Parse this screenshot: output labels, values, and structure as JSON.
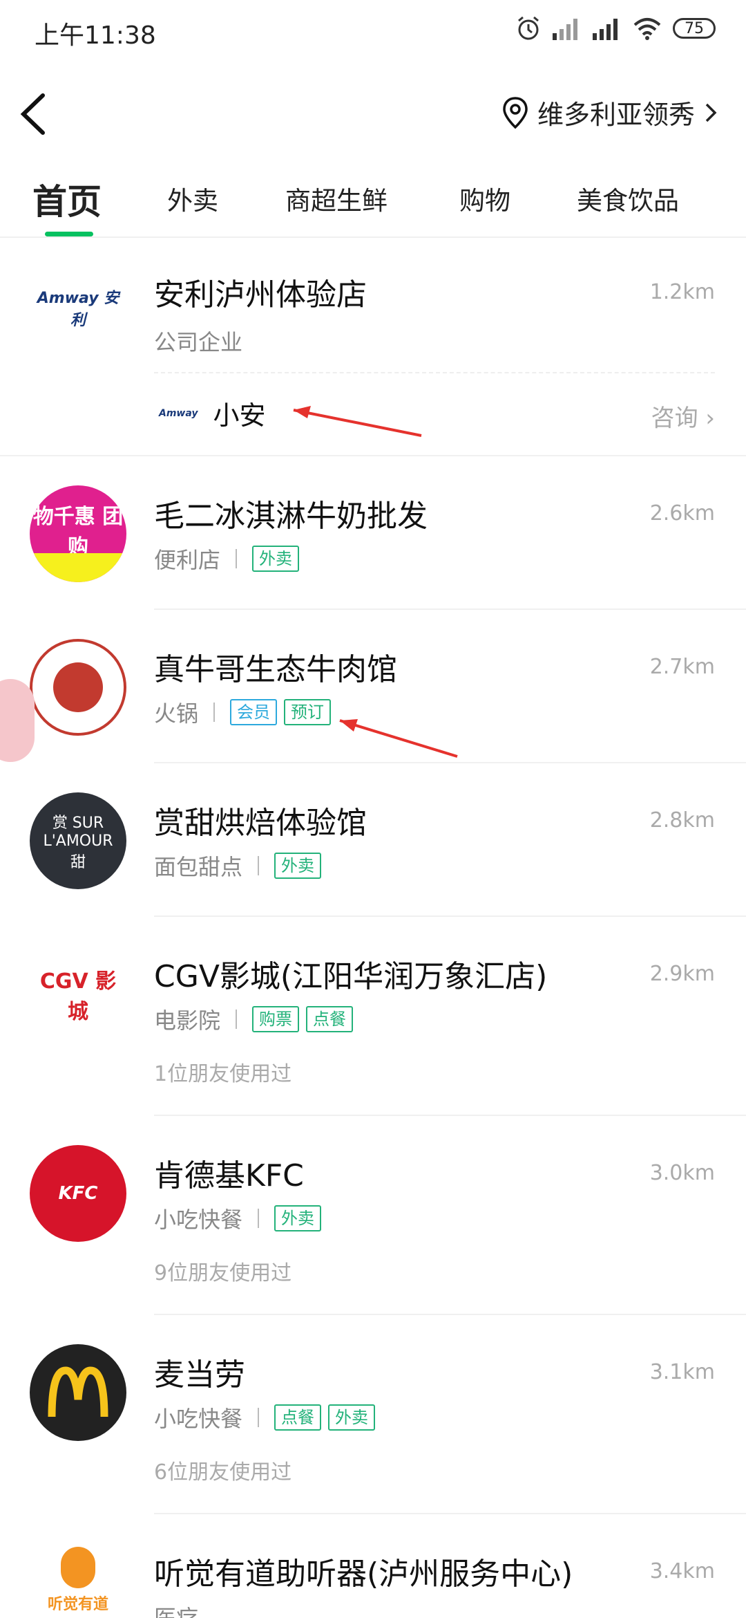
{
  "status": {
    "time": "上午11:38",
    "battery": "75"
  },
  "nav": {
    "location": "维多利亚领秀"
  },
  "tabs": [
    "首页",
    "外卖",
    "商超生鲜",
    "购物",
    "美食饮品"
  ],
  "stores": [
    {
      "name": "安利泸州体验店",
      "category": "公司企业",
      "distance": "1.2km",
      "logo_text": "Amway 安利",
      "assistant": {
        "name": "小安",
        "action": "咨询"
      }
    },
    {
      "name": "毛二冰淇淋牛奶批发",
      "category": "便利店",
      "tags": [
        "外卖"
      ],
      "distance": "2.6km",
      "logo_text": "物千惠 团购"
    },
    {
      "name": "真牛哥生态牛肉馆",
      "category": "火锅",
      "tags": [
        "会员",
        "预订"
      ],
      "distance": "2.7km"
    },
    {
      "name": "赏甜烘焙体验馆",
      "category": "面包甜点",
      "tags": [
        "外卖"
      ],
      "distance": "2.8km",
      "logo_text": "赏 SUR L'AMOUR 甜"
    },
    {
      "name": "CGV影城(江阳华润万象汇店)",
      "category": "电影院",
      "tags": [
        "购票",
        "点餐"
      ],
      "distance": "2.9km",
      "friends": "1位朋友使用过",
      "logo_text": "CGV 影城"
    },
    {
      "name": "肯德基KFC",
      "category": "小吃快餐",
      "tags": [
        "外卖"
      ],
      "distance": "3.0km",
      "friends": "9位朋友使用过",
      "logo_text": "KFC"
    },
    {
      "name": "麦当劳",
      "category": "小吃快餐",
      "tags": [
        "点餐",
        "外卖"
      ],
      "distance": "3.1km",
      "friends": "6位朋友使用过"
    },
    {
      "name": "听觉有道助听器(泸州服务中心)",
      "category": "医疗",
      "distance": "3.4km",
      "logo_text": "听觉有道"
    }
  ],
  "colors": {
    "accent": "#07c160",
    "tag_green": "#23b27a",
    "tag_blue": "#2da9dd",
    "annotation": "#e5322d"
  }
}
